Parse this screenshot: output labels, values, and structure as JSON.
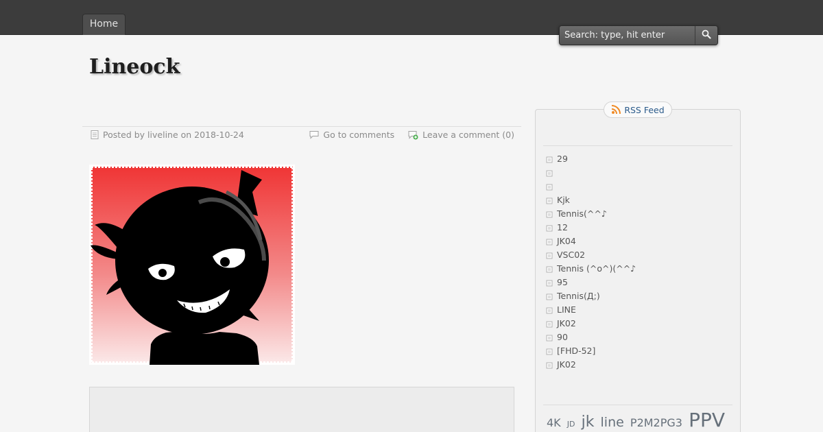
{
  "nav": {
    "home_label": "Home"
  },
  "search": {
    "placeholder": "Search: type, hit enter"
  },
  "site": {
    "title": "Lineock"
  },
  "post": {
    "meta_posted": "Posted by liveline on 2018-10-24",
    "go_to_comments": "Go to comments",
    "leave_comment": "Leave a comment (0)"
  },
  "sidebar": {
    "rss_label": "RSS Feed",
    "items": [
      "29",
      "",
      "",
      "Kjk",
      "Tennis(^^♪",
      "12",
      "JK04",
      "VSC02",
      "Tennis (^o^)(^^♪",
      "95",
      "Tennis(Д;)",
      "LINE",
      "JK02",
      "90",
      "[FHD-52]",
      "JK02"
    ],
    "tags": [
      {
        "label": "4K",
        "size": 16
      },
      {
        "label": "JD",
        "size": 11
      },
      {
        "label": "jk",
        "size": 22
      },
      {
        "label": "line",
        "size": 19
      },
      {
        "label": "P2M2PG3",
        "size": 16
      },
      {
        "label": "PPV",
        "size": 28
      }
    ]
  },
  "colors": {
    "topbar": "#3c3c3c",
    "background": "#f5f5f5",
    "rss_link": "#2a5a8a",
    "image_red": "#f03535"
  },
  "icons": [
    "search-icon",
    "post-meta-icon",
    "comment-bubble-icon",
    "add-comment-icon",
    "rss-icon",
    "bullet-icon"
  ]
}
